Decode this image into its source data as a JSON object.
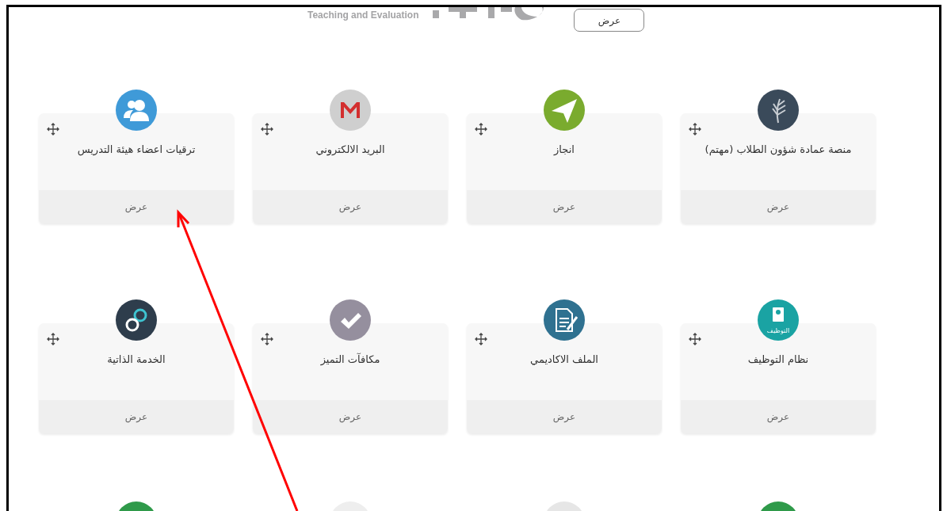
{
  "header": {
    "tagline": "Teaching and Evaluation",
    "view_button": "عرض"
  },
  "cards": [
    {
      "title": "منصة عمادة شؤون الطلاب (مهتم)",
      "kind": "wheat",
      "color": "#3a4a5a",
      "action": "عرض"
    },
    {
      "title": "انجاز",
      "kind": "plane",
      "color": "#7aab2e",
      "action": "عرض"
    },
    {
      "title": "البريد الالكتروني",
      "kind": "mail",
      "color": "#cfcfcf",
      "action": "عرض"
    },
    {
      "title": "ترقيات اعضاء هيئة التدريس",
      "kind": "people",
      "color": "#3f9ad8",
      "action": "عرض"
    },
    {
      "title": "نظام التوظيف",
      "kind": "employment",
      "color": "#1aa3a3",
      "action": "عرض",
      "icon_text": "التوظيف"
    },
    {
      "title": "الملف الاكاديمي",
      "kind": "document",
      "color": "#2f7190",
      "action": "عرض"
    },
    {
      "title": "مكافآت التميز",
      "kind": "check",
      "color": "#958f9e",
      "action": "عرض"
    },
    {
      "title": "الخدمة الذاتية",
      "kind": "rings",
      "color": "#2e3d4c",
      "action": "عرض"
    }
  ],
  "partial_icons": [
    {
      "color": "#2f9a4a"
    },
    {
      "color": "#e6e6e6"
    },
    {
      "color": "#eeeeee"
    },
    {
      "color": "#2f9a4a"
    }
  ]
}
